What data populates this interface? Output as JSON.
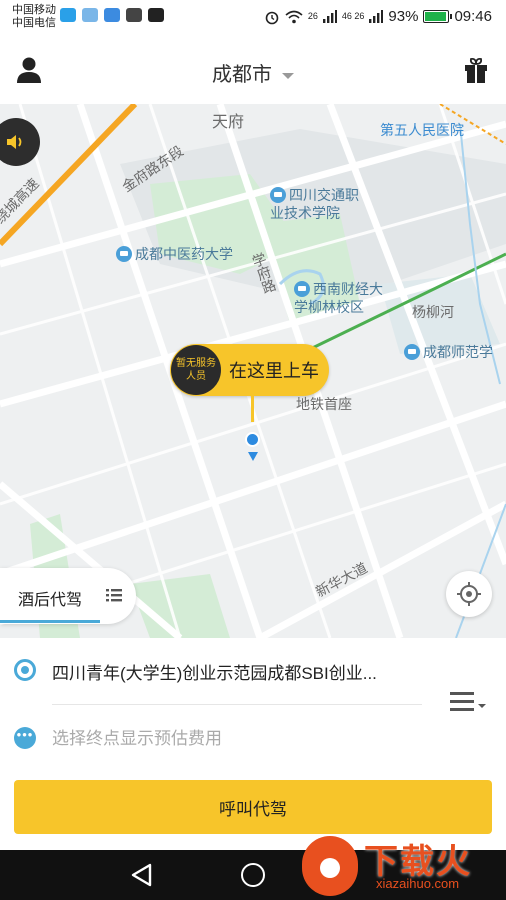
{
  "status_bar": {
    "carrier1": "中国移动",
    "carrier2": "中国电信",
    "network1": "26",
    "network2": "46 26",
    "battery_percent": "93%",
    "battery_level": 0.93,
    "time": "09:46",
    "icons": [
      "alarm-icon",
      "wifi-icon",
      "signal-icon",
      "battery-icon"
    ],
    "app_icons": [
      "app-icon-1",
      "app-icon-2",
      "app-icon-3",
      "wechat-icon",
      "tiktok-icon"
    ]
  },
  "header": {
    "city": "成都市",
    "left_icon": "user-icon",
    "right_icon": "gift-icon"
  },
  "map": {
    "labels": {
      "tianfu": "天府",
      "hospital": "第五人民医院",
      "jinfu_road": "金府路东段",
      "ring_road": "绕城高速",
      "sctc": "四川交通职\n业技术学院",
      "tcm_univ": "成都中医药大学",
      "xuefu_road": "学府路",
      "swufe": "西南财经大\n学柳林校区",
      "yangliuhe": "杨柳河",
      "cd_normal": "成都师范学",
      "metro": "地铁首座",
      "xinhua": "新华大道"
    },
    "pickup": {
      "avatar_text": "暂无服务\n人员",
      "label": "在这里上车"
    },
    "drunk_tab": "酒后代驾",
    "colors": {
      "road_major": "#f5a623",
      "metro_line": "#4caf50",
      "park": "#d4ecd6"
    }
  },
  "panel": {
    "start_address": "四川青年(大学生)创业示范园成都SBI创业...",
    "end_placeholder": "选择终点显示预估费用",
    "call_button": "呼叫代驾",
    "accent": "#f7c52a"
  },
  "watermark": {
    "text": "下载火",
    "url": "xiazaihuo.com"
  }
}
